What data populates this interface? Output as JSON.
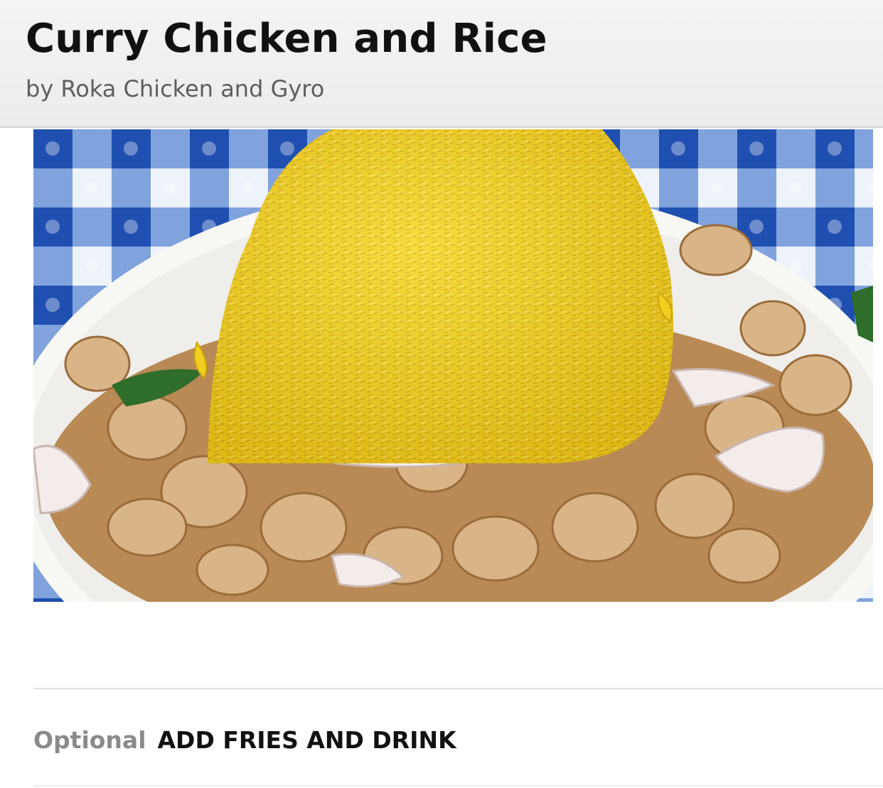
{
  "header": {
    "title": "Curry Chicken and Rice",
    "subtitle": "by Roka Chicken and Gyro"
  },
  "photo": {
    "icon": "food-photo-icon"
  },
  "option": {
    "tag": "Optional",
    "name": "ADD FRIES AND DRINK"
  },
  "colors": {
    "rice": "#f2cf1e",
    "tablecloth": "#2c5eb8",
    "plate": "#f7f7f4",
    "chicken": "#c79a62"
  }
}
